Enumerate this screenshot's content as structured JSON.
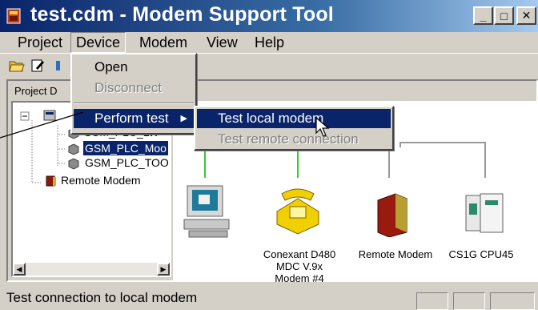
{
  "window": {
    "title": "test.cdm - Modem Support Tool",
    "controls": {
      "minimize": "_",
      "maximize": "□",
      "close": "✕"
    }
  },
  "menubar": {
    "items": [
      "Project",
      "Device",
      "Modem",
      "View",
      "Help"
    ],
    "open_menu": "Device"
  },
  "toolbar": {
    "icons": [
      "open-folder-icon",
      "edit-icon",
      "network-icon"
    ]
  },
  "project_panel": {
    "label": "Project D",
    "tree": {
      "nodes": [
        {
          "label": "GSM_PLC_LW",
          "icon": "modem-icon"
        },
        {
          "label": "GSM_PLC_Moo",
          "icon": "modem-icon",
          "selected": true
        },
        {
          "label": "GSM_PLC_TOO",
          "icon": "modem-icon"
        },
        {
          "label": "Remote Modem",
          "icon": "remote-modem-icon"
        }
      ]
    }
  },
  "device_menu": {
    "items": [
      {
        "label": "Open",
        "enabled": true
      },
      {
        "label": "Disconnect",
        "enabled": false
      },
      {
        "label": "Perform test",
        "enabled": true,
        "highlighted": true,
        "submenu": true
      }
    ]
  },
  "perform_test_submenu": {
    "items": [
      {
        "label": "Test local modem",
        "enabled": true,
        "highlighted": true
      },
      {
        "label": "Test remote connection",
        "enabled": false
      }
    ]
  },
  "network": {
    "devices": [
      {
        "icon": "computer-icon",
        "label": ""
      },
      {
        "icon": "telephone-modem-icon",
        "label": "Conexant D480 MDC V.9x Modem #4"
      },
      {
        "icon": "remote-modem-icon",
        "label": "Remote Modem"
      },
      {
        "icon": "plc-icon",
        "label": "CS1G CPU45"
      }
    ],
    "colors": {
      "link": "#33cc33",
      "bus": "#999999"
    }
  },
  "statusbar": {
    "text": "Test connection to local modem"
  },
  "colors": {
    "titlebar": "#0a246a",
    "highlight": "#0a246a",
    "face": "#d4d0c8"
  }
}
